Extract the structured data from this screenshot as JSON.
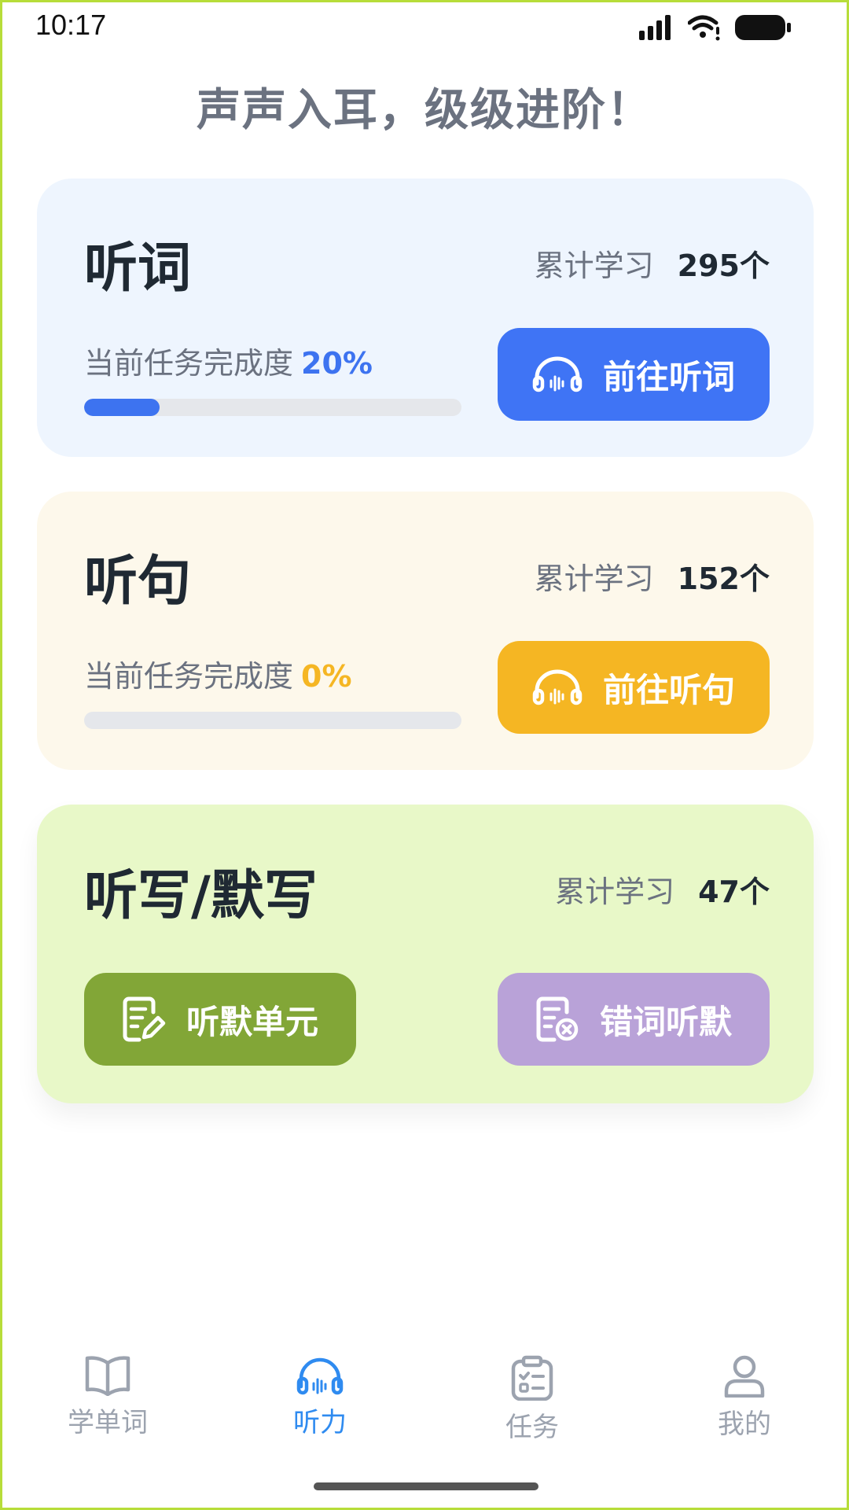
{
  "status_bar": {
    "time": "10:17"
  },
  "header": {
    "title": "声声入耳，级级进阶！"
  },
  "cards": {
    "words": {
      "title": "听词",
      "stat_label": "累计学习",
      "stat_value": "295个",
      "progress_label": "当前任务完成度",
      "progress_value": "20%",
      "progress_fraction": 0.2,
      "button_label": "前往听词",
      "button_icon": "headphones-icon",
      "accent": "#3f74f5"
    },
    "sentences": {
      "title": "听句",
      "stat_label": "累计学习",
      "stat_value": "152个",
      "progress_label": "当前任务完成度",
      "progress_value": "0%",
      "progress_fraction": 0,
      "button_label": "前往听句",
      "button_icon": "headphones-icon",
      "accent": "#f5b623"
    },
    "dictation": {
      "title": "听写/默写",
      "stat_label": "累计学习",
      "stat_value": "47个",
      "unit_button_label": "听默单元",
      "unit_button_icon": "edit-document-icon",
      "unit_button_color": "#82a637",
      "wrong_button_label": "错词听默",
      "wrong_button_icon": "wrong-document-icon",
      "wrong_button_color": "#b9a2d8"
    }
  },
  "bottom_nav": {
    "items": [
      {
        "label": "学单词",
        "icon": "book-icon",
        "active": false
      },
      {
        "label": "听力",
        "icon": "headphones-icon",
        "active": true
      },
      {
        "label": "任务",
        "icon": "clipboard-icon",
        "active": false
      },
      {
        "label": "我的",
        "icon": "user-icon",
        "active": false
      }
    ],
    "active_color": "#2f8bf0",
    "inactive_color": "#9ca3af"
  }
}
